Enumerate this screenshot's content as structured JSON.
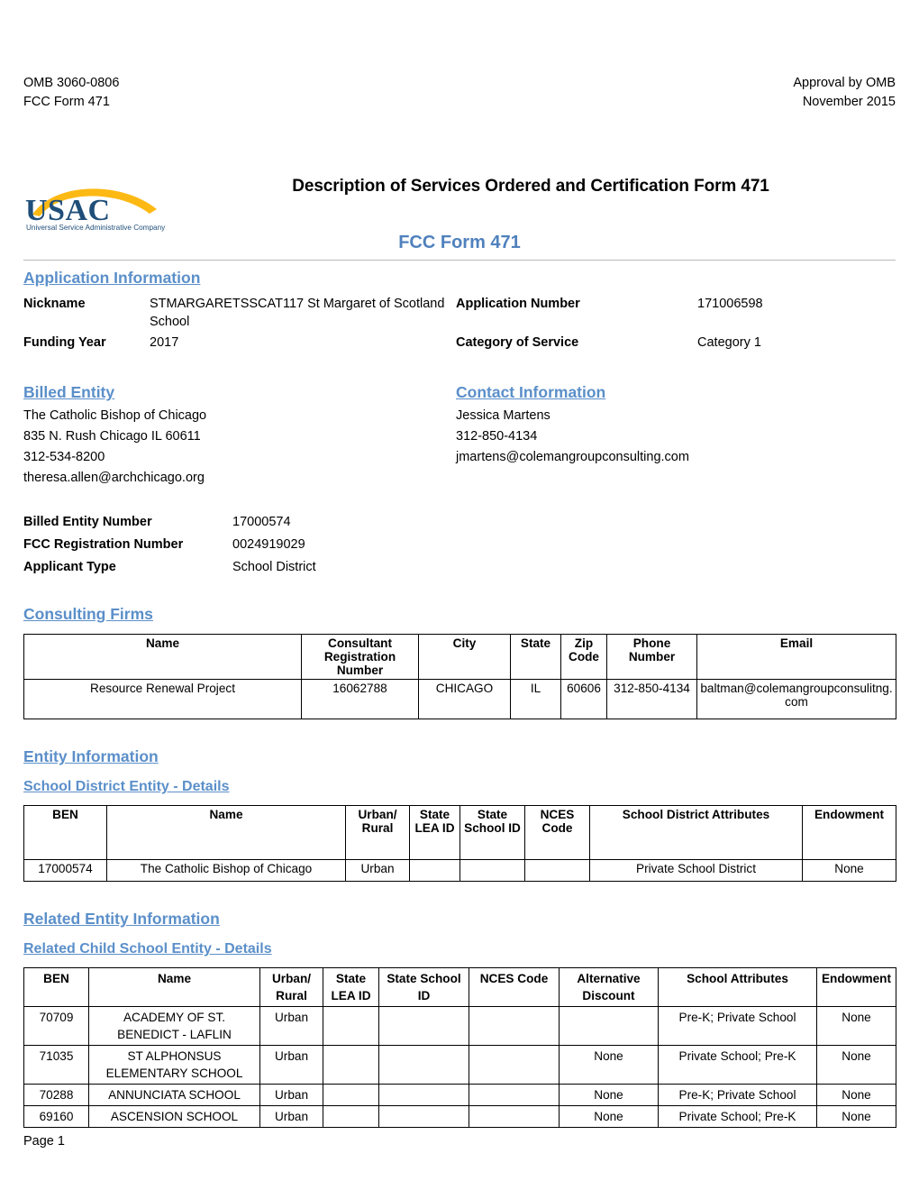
{
  "header": {
    "omb_number": "OMB 3060-0806",
    "form_code": "FCC Form 471",
    "approval": "Approval by OMB",
    "approval_date": "November 2015",
    "document_title": "Description of Services Ordered and Certification Form 471",
    "form_heading": "FCC Form 471",
    "logo": {
      "wordmark": "USAC",
      "tagline": "Universal Service Administrative Company",
      "wordmark_color": "#1F4E79",
      "swoosh_color": "#FDB913"
    }
  },
  "application_information": {
    "heading": "Application Information",
    "nickname_label": "Nickname",
    "nickname_value": "STMARGARETSSCAT117 St Margaret of Scotland School",
    "application_number_label": "Application Number",
    "application_number_value": "171006598",
    "funding_year_label": "Funding Year",
    "funding_year_value": "2017",
    "category_of_service_label": "Category of Service",
    "category_of_service_value": "Category 1"
  },
  "billed_entity": {
    "heading": "Billed Entity",
    "name": "The Catholic Bishop of Chicago",
    "address": "835 N. Rush  Chicago IL 60611",
    "phone": "312-534-8200",
    "email": "theresa.allen@archchicago.org"
  },
  "contact_information": {
    "heading": "Contact Information",
    "name": "Jessica Martens",
    "phone": "312-850-4134",
    "email": "jmartens@colemangroupconsulting.com"
  },
  "entity_numbers": {
    "billed_entity_number_label": "Billed Entity Number",
    "billed_entity_number_value": "17000574",
    "fcc_registration_number_label": "FCC Registration Number",
    "fcc_registration_number_value": "0024919029",
    "applicant_type_label": "Applicant Type",
    "applicant_type_value": "School District"
  },
  "consulting_firms": {
    "heading": "Consulting Firms",
    "columns": [
      "Name",
      "Consultant Registration Number",
      "City",
      "State",
      "Zip Code",
      "Phone Number",
      "Email"
    ],
    "rows": [
      {
        "name": "Resource Renewal Project",
        "registration_number": "16062788",
        "city": "CHICAGO",
        "state": "IL",
        "zip_code": "60606",
        "phone_number": "312-850-4134",
        "email": "baltman@colemangroupconsulitng.com"
      }
    ]
  },
  "entity_information": {
    "heading": "Entity Information",
    "school_district_heading": "School District Entity - Details",
    "columns": [
      "BEN",
      "Name",
      "Urban/ Rural",
      "State LEA ID",
      "State School ID",
      "NCES Code",
      "School District Attributes",
      "Endowment"
    ],
    "rows": [
      {
        "ben": "17000574",
        "name": "The Catholic Bishop of Chicago",
        "urban_rural": "Urban",
        "state_lea_id": "",
        "state_school_id": "",
        "nces_code": "",
        "attributes": "Private School District",
        "endowment": "None"
      }
    ]
  },
  "related_entity_information": {
    "heading": "Related Entity Information",
    "child_school_heading": "Related Child School Entity - Details",
    "columns": [
      "BEN",
      "Name",
      "Urban/ Rural",
      "State LEA ID",
      "State School ID",
      "NCES Code",
      "Alternative Discount",
      "School Attributes",
      "Endowment"
    ],
    "rows": [
      {
        "ben": "70709",
        "name": "ACADEMY OF ST. BENEDICT - LAFLIN",
        "urban_rural": "Urban",
        "state_lea_id": "",
        "state_school_id": "",
        "nces_code": "",
        "alternative_discount": "",
        "attributes": "Pre-K; Private School",
        "endowment": "None"
      },
      {
        "ben": "71035",
        "name": "ST ALPHONSUS ELEMENTARY SCHOOL",
        "urban_rural": "Urban",
        "state_lea_id": "",
        "state_school_id": "",
        "nces_code": "",
        "alternative_discount": "None",
        "attributes": "Private School; Pre-K",
        "endowment": "None"
      },
      {
        "ben": "70288",
        "name": "ANNUNCIATA SCHOOL",
        "urban_rural": "Urban",
        "state_lea_id": "",
        "state_school_id": "",
        "nces_code": "",
        "alternative_discount": "None",
        "attributes": "Pre-K; Private School",
        "endowment": "None"
      },
      {
        "ben": "69160",
        "name": "ASCENSION SCHOOL",
        "urban_rural": "Urban",
        "state_lea_id": "",
        "state_school_id": "",
        "nces_code": "",
        "alternative_discount": "None",
        "attributes": "Private School; Pre-K",
        "endowment": "None"
      }
    ]
  },
  "footer": {
    "page_label": "Page 1"
  }
}
